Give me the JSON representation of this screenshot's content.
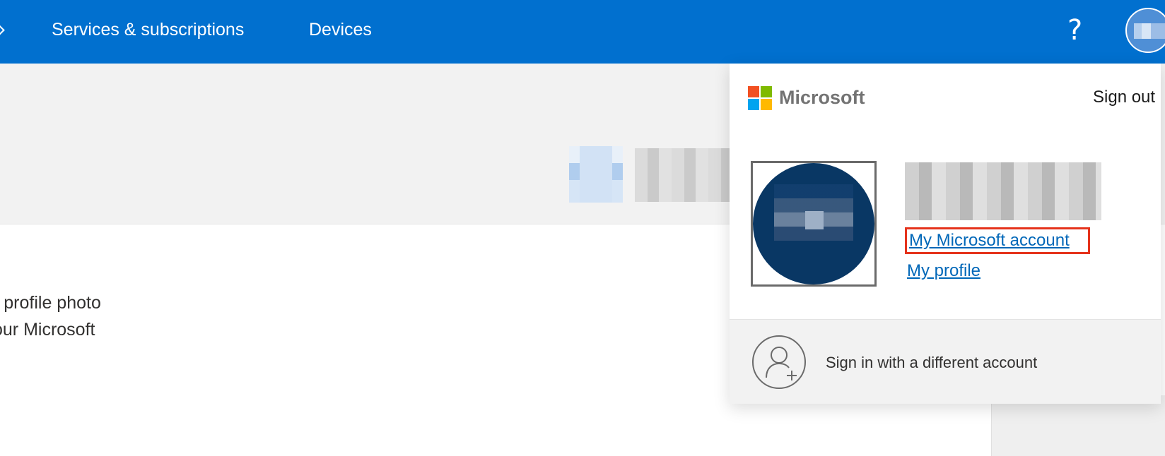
{
  "nav": {
    "services": "Services & subscriptions",
    "devices": "Devices",
    "help": "?"
  },
  "body": {
    "line1": "r profile photo",
    "line2": "our Microsoft"
  },
  "account_menu": {
    "brand": "Microsoft",
    "sign_out": "Sign out",
    "my_account_link": "My Microsoft account",
    "my_profile_link": "My profile",
    "different_account": "Sign in with a different account"
  },
  "colors": {
    "nav_blue": "#0170cf",
    "link_blue": "#0067b8",
    "highlight_red": "#e5331c",
    "logo_red": "#f25022",
    "logo_green": "#7fba00",
    "logo_blue": "#00a4ef",
    "logo_yellow": "#ffb900"
  },
  "icons": {
    "help": "question-mark-icon",
    "add_account": "person-add-icon",
    "logo": "microsoft-logo"
  }
}
